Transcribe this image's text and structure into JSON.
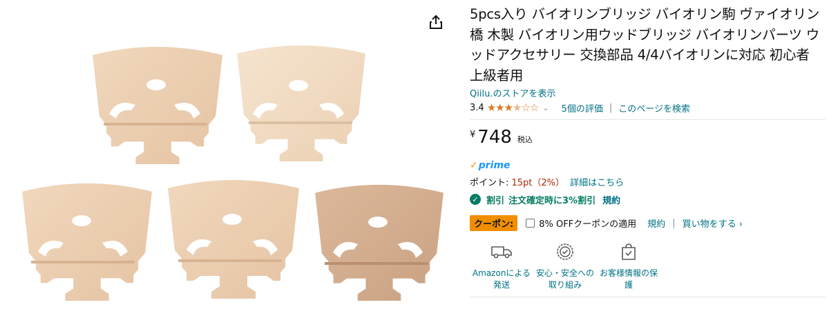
{
  "product": {
    "title": "5pcs入り バイオリンブリッジ バイオリン駒 ヴァイオリン 橋 木製 バイオリン用ウッドブリッジ バイオリンパーツ ウッドアクセサリー 交換部品 4/4バイオリンに対応 初心者 上級者用",
    "store_link": "Qiilu.のストアを表示",
    "rating_value": "3.4",
    "stars_full": "★★★",
    "stars_half": "★",
    "stars_empty": "☆☆",
    "rating_chevron": "⌄",
    "reviews_link": "5個の評価",
    "separator": "|",
    "search_page_link": "このページを検索"
  },
  "price": {
    "symbol": "¥",
    "value": "748",
    "tax_label": "税込"
  },
  "prime": {
    "check": "✓",
    "word": "prime"
  },
  "points": {
    "label": "ポイント: ",
    "value": "15pt（2%）",
    "detail_link": "詳細はこちら"
  },
  "discount": {
    "check": "✓",
    "label": "割引",
    "detail": "注文確定時に3%割引",
    "terms_link": "規約"
  },
  "coupon": {
    "badge": "クーポン:",
    "text": "8% OFFクーポンの適用",
    "terms_link": "規約",
    "separator": "|",
    "shop_link": "買い物をする ›"
  },
  "features": [
    {
      "icon": "delivery-truck-icon",
      "label": "Amazonによる発送"
    },
    {
      "icon": "shield-badge-icon",
      "label": "安心・安全への取り組み"
    },
    {
      "icon": "secure-bag-icon",
      "label": "お客様情報の保護"
    }
  ],
  "images": {
    "icon": "violin-bridge-photo",
    "share_icon": "share-icon"
  },
  "colors": {
    "link": "#007185",
    "price_red": "#b12704",
    "star": "#de7921",
    "success_green": "#067d62",
    "coupon_orange": "#f18e00",
    "prime_blue": "#1a98ff",
    "wood_light": "#f2dcc3",
    "wood_mid": "#e6c6a6",
    "wood_dark": "#d8b596"
  }
}
